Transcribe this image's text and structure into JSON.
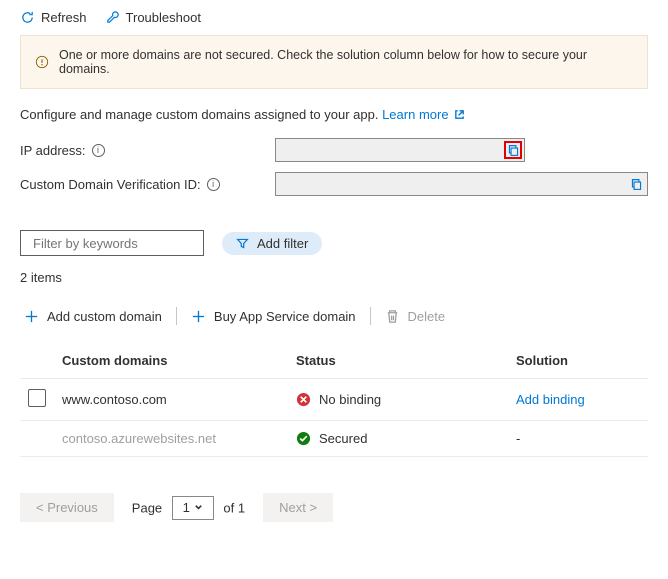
{
  "toolbar": {
    "refresh": "Refresh",
    "troubleshoot": "Troubleshoot"
  },
  "warning": "One or more domains are not secured. Check the solution column below for how to secure your domains.",
  "description": "Configure and manage custom domains assigned to your app.",
  "learn_more": "Learn more",
  "fields": {
    "ip_label": "IP address:",
    "ip_value": "",
    "verify_label": "Custom Domain Verification ID:",
    "verify_value": ""
  },
  "filter": {
    "placeholder": "Filter by keywords",
    "add_filter": "Add filter"
  },
  "count": "2 items",
  "actions": {
    "add": "Add custom domain",
    "buy": "Buy App Service domain",
    "delete": "Delete"
  },
  "table": {
    "headers": {
      "domain": "Custom domains",
      "status": "Status",
      "solution": "Solution"
    },
    "rows": [
      {
        "domain": "www.contoso.com",
        "status": "No binding",
        "status_kind": "error",
        "solution": "Add binding",
        "selectable": true
      },
      {
        "domain": "contoso.azurewebsites.net",
        "status": "Secured",
        "status_kind": "ok",
        "solution": "-",
        "selectable": false
      }
    ]
  },
  "pager": {
    "prev": "< Previous",
    "page_label": "Page",
    "page_num": "1",
    "page_of": "of 1",
    "next": "Next >"
  }
}
